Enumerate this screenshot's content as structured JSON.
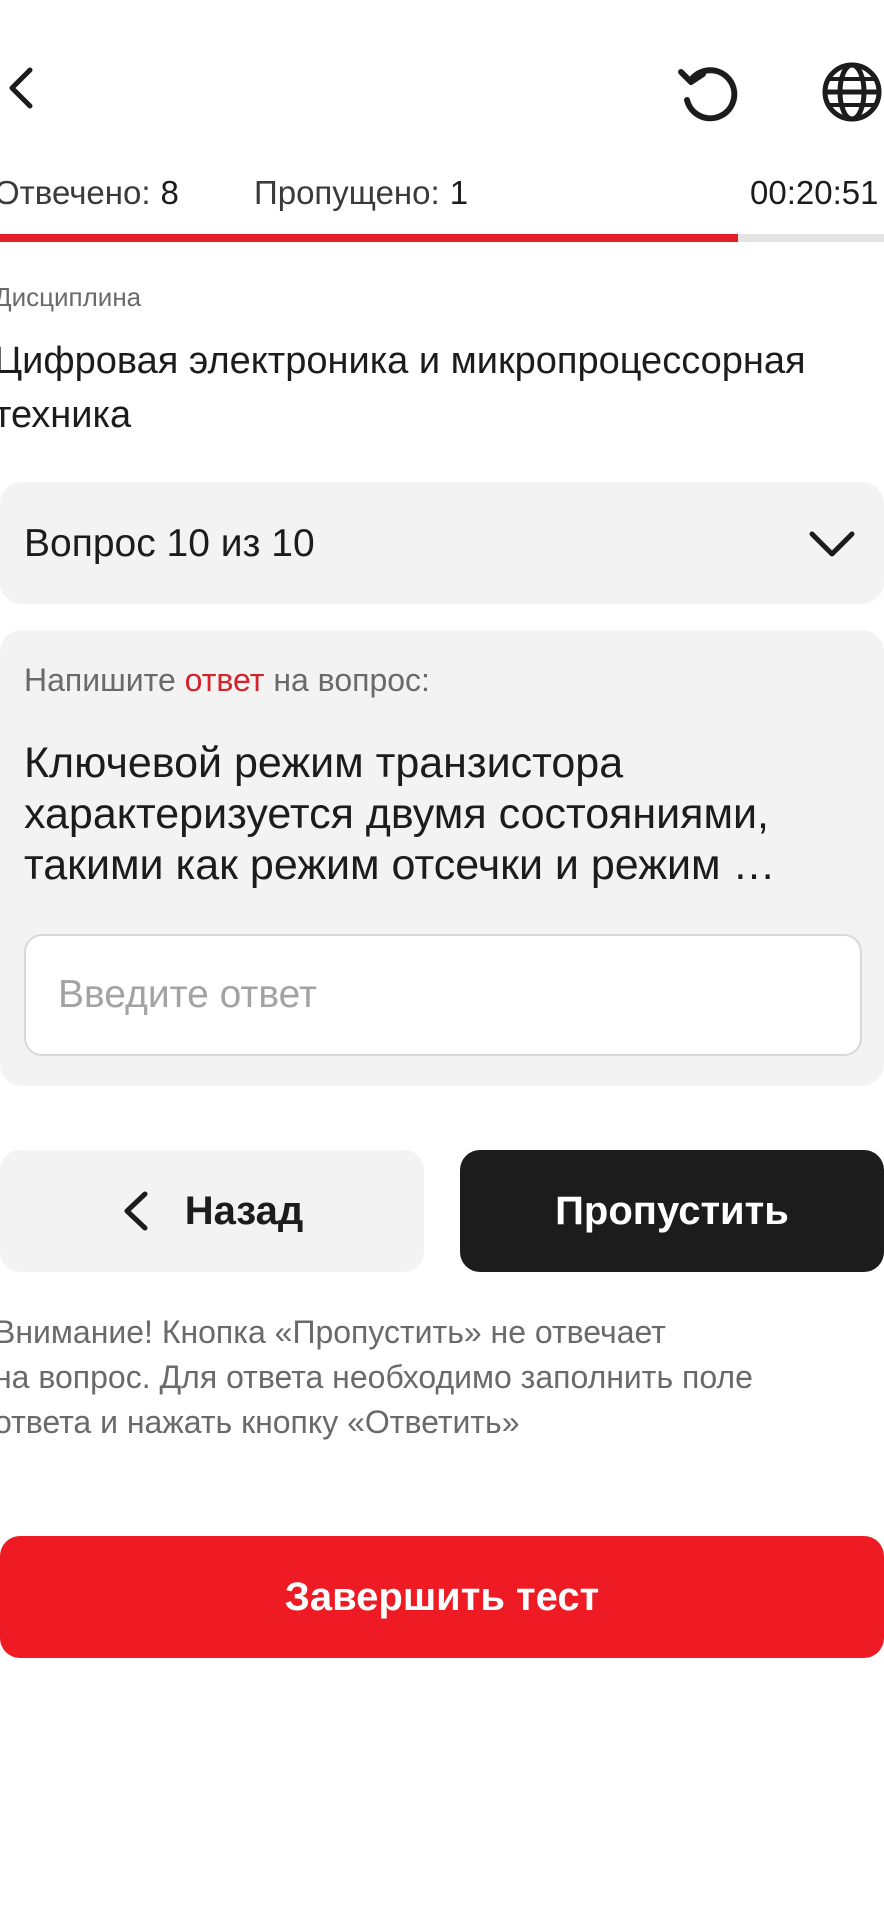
{
  "header": {
    "back_icon": "chevron-left-icon",
    "refresh_icon": "refresh-icon",
    "language_icon": "globe-icon"
  },
  "stats": {
    "answered_label": "Отвечено:",
    "answered_count": "8",
    "skipped_label": "Пропущено:",
    "skipped_count": "1",
    "timer": "00:20:51"
  },
  "progress": {
    "fraction": 0.835,
    "fill_color": "#e3202a",
    "track_color": "#e4e4e4"
  },
  "discipline": {
    "label": "Дисциплина",
    "value": "Цифровая электроника и микропроцессорная техника"
  },
  "question_selector": {
    "label": "Вопрос 10 из 10",
    "icon": "chevron-down-icon"
  },
  "question": {
    "prompt_before": "Напишите ",
    "prompt_accent": "ответ",
    "prompt_after": " на вопрос:",
    "text_lines": [
      "Ключевой режим транзистора",
      "характеризуется двумя состояниями,",
      "такими как режим отсечки и режим …"
    ],
    "answer_placeholder": "Введите ответ",
    "answer_value": ""
  },
  "buttons": {
    "back_label": "Назад",
    "skip_label": "Пропустить",
    "finish_label": "Завершить тест"
  },
  "warning": {
    "lines": [
      "Внимание! Кнопка «Пропустить» не отвечает",
      "на вопрос. Для ответа необходимо заполнить поле",
      "ответа и нажать кнопку «Ответить»"
    ]
  },
  "colors": {
    "accent": "#d3232b",
    "finish_button": "#ee1b24",
    "dark_button": "#1c1c1c",
    "card_bg": "#f3f3f3"
  }
}
